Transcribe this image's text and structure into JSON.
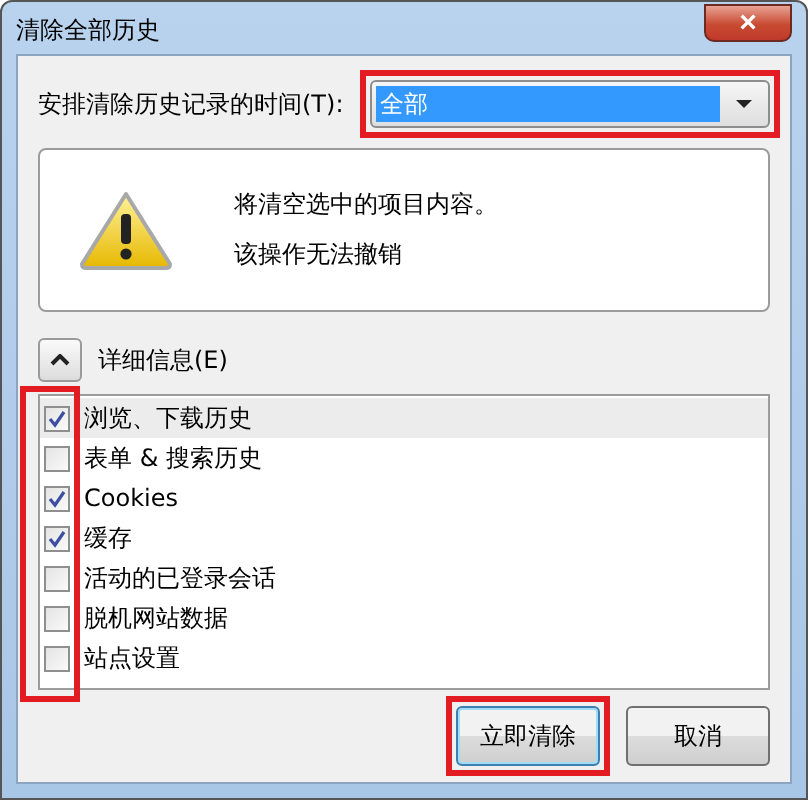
{
  "window": {
    "title": "清除全部历史",
    "close": "×"
  },
  "time_range": {
    "label": "安排清除历史记录的时间(T):",
    "value": "全部",
    "highlighted": true
  },
  "message": {
    "lines": [
      "将清空选中的项目内容。",
      "该操作无法撤销"
    ]
  },
  "details": {
    "label": "详细信息(E)",
    "expanded": true
  },
  "checkbox_column_highlighted": true,
  "items": [
    {
      "label": "浏览、下载历史",
      "checked": true,
      "selected": true
    },
    {
      "label": "表单 & 搜索历史",
      "checked": false,
      "selected": false
    },
    {
      "label": "Cookies",
      "checked": true,
      "selected": false
    },
    {
      "label": "缓存",
      "checked": true,
      "selected": false
    },
    {
      "label": "活动的已登录会话",
      "checked": false,
      "selected": false
    },
    {
      "label": "脱机网站数据",
      "checked": false,
      "selected": false
    },
    {
      "label": "站点设置",
      "checked": false,
      "selected": false
    }
  ],
  "buttons": [
    {
      "label": "立即清除",
      "highlighted": true,
      "default": true
    },
    {
      "label": "取消",
      "highlighted": false,
      "default": false
    }
  ]
}
